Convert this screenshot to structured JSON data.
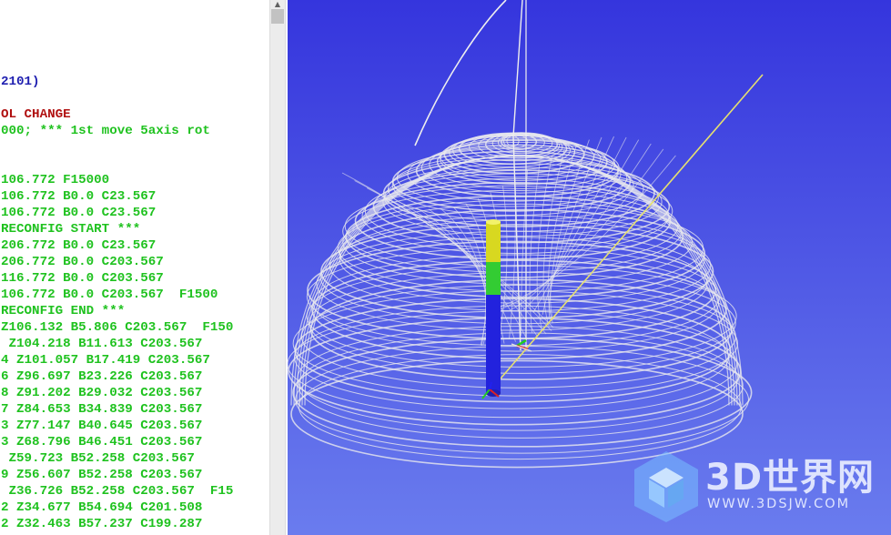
{
  "editor": {
    "lines": [
      {
        "text": "2101)",
        "color": "blue"
      },
      {
        "text": "",
        "color": "green"
      },
      {
        "text": "OL CHANGE",
        "color": "red"
      },
      {
        "text": "000; *** 1st move 5axis rot",
        "color": "green"
      },
      {
        "text": "",
        "color": "green"
      },
      {
        "text": "",
        "color": "green"
      },
      {
        "text": "106.772 F15000",
        "color": "green"
      },
      {
        "text": "106.772 B0.0 C23.567",
        "color": "green"
      },
      {
        "text": "106.772 B0.0 C23.567",
        "color": "green"
      },
      {
        "text": "RECONFIG START ***",
        "color": "green"
      },
      {
        "text": "206.772 B0.0 C23.567",
        "color": "green"
      },
      {
        "text": "206.772 B0.0 C203.567",
        "color": "green"
      },
      {
        "text": "116.772 B0.0 C203.567",
        "color": "green"
      },
      {
        "text": "106.772 B0.0 C203.567  F1500",
        "color": "green"
      },
      {
        "text": "RECONFIG END ***",
        "color": "green"
      },
      {
        "text": "Z106.132 B5.806 C203.567  F150",
        "color": "green"
      },
      {
        "text": " Z104.218 B11.613 C203.567",
        "color": "green"
      },
      {
        "text": "4 Z101.057 B17.419 C203.567",
        "color": "green"
      },
      {
        "text": "6 Z96.697 B23.226 C203.567",
        "color": "green"
      },
      {
        "text": "8 Z91.202 B29.032 C203.567",
        "color": "green"
      },
      {
        "text": "7 Z84.653 B34.839 C203.567",
        "color": "green"
      },
      {
        "text": "3 Z77.147 B40.645 C203.567",
        "color": "green"
      },
      {
        "text": "3 Z68.796 B46.451 C203.567",
        "color": "green"
      },
      {
        "text": " Z59.723 B52.258 C203.567",
        "color": "green"
      },
      {
        "text": "9 Z56.607 B52.258 C203.567",
        "color": "green"
      },
      {
        "text": " Z36.726 B52.258 C203.567  F15",
        "color": "green"
      },
      {
        "text": "2 Z34.677 B54.694 C201.508",
        "color": "green"
      },
      {
        "text": "2 Z32.463 B57.237 C199.287",
        "color": "green"
      }
    ]
  },
  "scrollbar": {
    "up_arrow": "▲"
  },
  "viewport": {
    "background_top": "#3535dd",
    "background_bottom": "#6a7cee",
    "toolpath_color": "#e8e8ee",
    "tool_segments": [
      "#d8d820",
      "#33cc33",
      "#2222dd"
    ]
  },
  "watermark": {
    "title": "3D世界网",
    "url": "WWW.3DSJW.COM"
  }
}
